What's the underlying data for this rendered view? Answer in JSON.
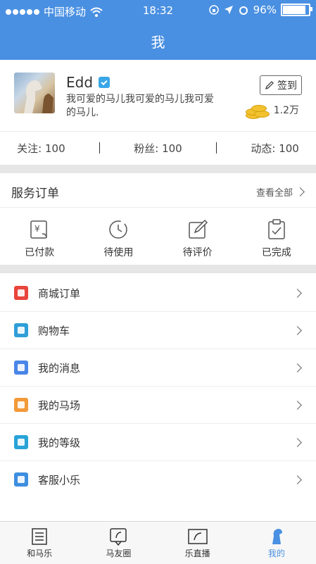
{
  "status_bar": {
    "carrier": "中国移动",
    "time": "18:32",
    "battery": "96%"
  },
  "nav": {
    "title": "我"
  },
  "profile": {
    "name": "Edd",
    "bio": "我可爱的马儿我可爱的马儿我可爱的马儿.",
    "sign_in_label": "签到",
    "coins": "1.2万"
  },
  "stats": [
    {
      "label": "关注: 100"
    },
    {
      "label": "粉丝: 100"
    },
    {
      "label": "动态: 100"
    }
  ],
  "orders": {
    "title": "服务订单",
    "view_all": "查看全部",
    "items": [
      {
        "label": "已付款",
        "icon": "payment-icon"
      },
      {
        "label": "待使用",
        "icon": "clock-icon"
      },
      {
        "label": "待评价",
        "icon": "edit-icon"
      },
      {
        "label": "已完成",
        "icon": "clipboard-check-icon"
      }
    ]
  },
  "menu": [
    {
      "label": "商城订单",
      "icon": "shop-order-icon",
      "color": "#e8453c"
    },
    {
      "label": "购物车",
      "icon": "cart-icon",
      "color": "#2f9fd8"
    },
    {
      "label": "我的消息",
      "icon": "bell-icon",
      "color": "#4a86e8"
    },
    {
      "label": "我的马场",
      "icon": "ranch-icon",
      "color": "#f29a38"
    },
    {
      "label": "我的等级",
      "icon": "level-icon",
      "color": "#29a3d8"
    },
    {
      "label": "客服小乐",
      "icon": "service-icon",
      "color": "#3d8fe0"
    }
  ],
  "tabs": [
    {
      "label": "和马乐",
      "icon": "home-icon"
    },
    {
      "label": "马友圈",
      "icon": "circle-icon"
    },
    {
      "label": "乐直播",
      "icon": "live-icon"
    },
    {
      "label": "我的",
      "icon": "me-icon"
    }
  ],
  "colors": {
    "accent": "#4a90e2"
  }
}
